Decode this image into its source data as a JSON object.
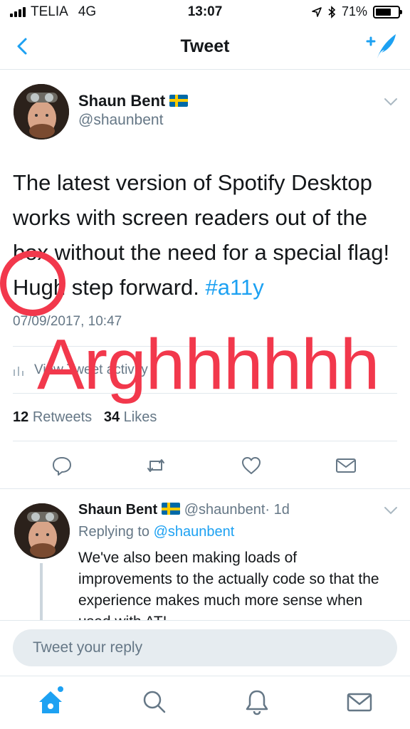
{
  "status_bar": {
    "carrier": "TELIA",
    "network": "4G",
    "time": "13:07",
    "battery_label": "71%",
    "battery_level": 0.71
  },
  "nav": {
    "title": "Tweet",
    "back_icon": "chevron-left-icon",
    "compose_icon": "compose-tweet-icon"
  },
  "tweet": {
    "author_name": "Shaun Bent",
    "author_handle": "@shaunbent",
    "flag_icon": "sweden-flag-icon",
    "text_lines": [
      "The latest version of Spotify Desktop",
      "works with screen readers out of the",
      "box without the need for a special flag!",
      "Hugh step forward."
    ],
    "hashtag": "#a11y",
    "date": "07/09/2017, 10:47",
    "activity_label": "View Tweet activity",
    "retweet_count": "12",
    "retweet_label": "Retweets",
    "like_count": "34",
    "like_label": "Likes"
  },
  "overlay": {
    "text": "Arghhhhhh",
    "color": "#f2384c"
  },
  "reply": {
    "author_name": "Shaun Bent",
    "author_handle": "@shaunbent",
    "age": "· 1d",
    "replying_prefix": "Replying to",
    "replying_handle": "@shaunbent",
    "text": "We've also been making loads of improvements to the actually code so that the experience makes much more sense when used with AT!"
  },
  "composer": {
    "placeholder": "Tweet your reply"
  },
  "tabs": [
    "home-icon",
    "search-icon",
    "notifications-icon",
    "messages-icon"
  ],
  "colors": {
    "accent": "#1da1f2",
    "text": "#14171a",
    "muted": "#657786",
    "border": "#e1e8ed"
  }
}
